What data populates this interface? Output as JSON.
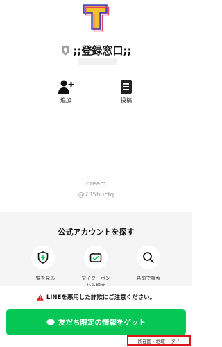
{
  "account": {
    "name": ";;登録窓口;;"
  },
  "actions": {
    "add_label": "追加",
    "post_label": "投稿"
  },
  "description": {
    "line1": "dream",
    "line2": "@735hucfq"
  },
  "find": {
    "title": "公式アカウントを探す",
    "items": [
      {
        "label": "一覧を見る",
        "icon": "shield-plus-icon"
      },
      {
        "label": "マイクーポン\nから探す",
        "icon": "coupon-icon"
      },
      {
        "label": "名前で検索",
        "icon": "search-icon"
      }
    ]
  },
  "warning": {
    "text": "LINEを悪用した詐欺にご注意ください。",
    "icon": "warning-icon"
  },
  "cta": {
    "label": "友だち限定の情報をゲット",
    "icon": "chat-bubble-icon"
  },
  "region": {
    "text": "所在国・地域： タイ"
  },
  "colors": {
    "accent_green": "#06c755",
    "warning_red": "#e0141b"
  }
}
